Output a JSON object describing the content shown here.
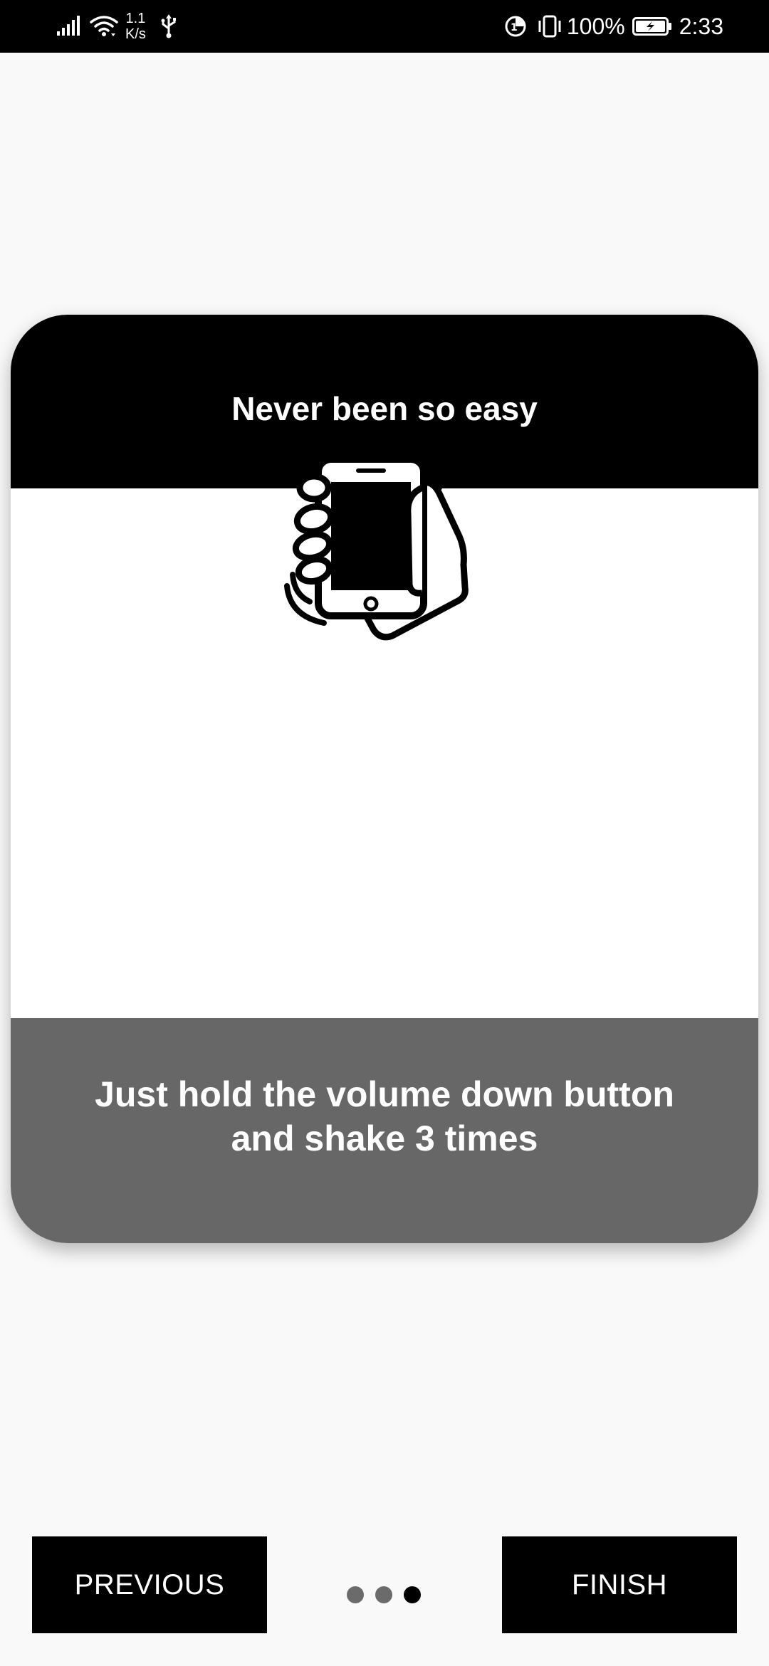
{
  "status_bar": {
    "net_speed_value": "1.1",
    "net_speed_unit": "K/s",
    "battery_percent": "100%",
    "time": "2:33",
    "icons": [
      "signal-icon",
      "wifi-icon",
      "usb-icon",
      "data-saver-icon",
      "vibrate-icon",
      "battery-charging-icon"
    ]
  },
  "card": {
    "title": "Never been so easy",
    "illustration_icon": "hand-shaking-phone-icon",
    "instruction": "Just hold the volume down button and shake 3 times"
  },
  "navigation": {
    "previous_label": "PREVIOUS",
    "finish_label": "FINISH",
    "pager": {
      "total_pages": 3,
      "current_page": 3
    }
  },
  "colors": {
    "header_bg": "#000000",
    "footer_bg": "#676767",
    "page_bg": "#f9f9f9",
    "button_bg": "#000000",
    "dot_inactive": "#6b6b6b",
    "dot_active": "#000000"
  }
}
